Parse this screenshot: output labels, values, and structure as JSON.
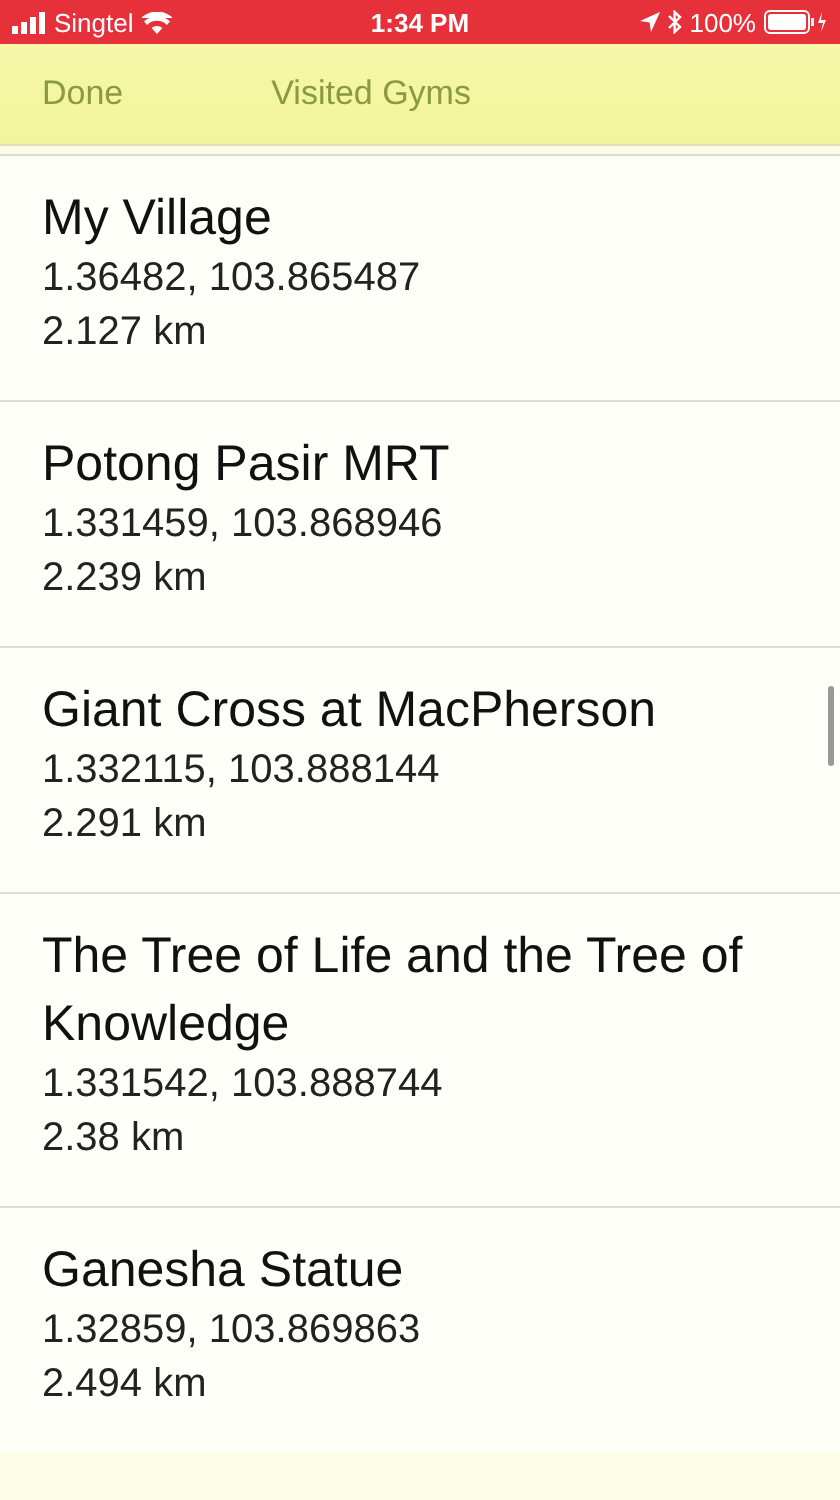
{
  "status_bar": {
    "carrier": "Singtel",
    "time": "1:34 PM",
    "battery": "100%"
  },
  "nav_bar": {
    "left_button": "Done",
    "title": "Visited Gyms"
  },
  "gyms": [
    {
      "name": "My Village",
      "coordinates": "1.36482, 103.865487",
      "distance": "2.127 km"
    },
    {
      "name": "Potong Pasir MRT",
      "coordinates": "1.331459, 103.868946",
      "distance": "2.239 km"
    },
    {
      "name": "Giant Cross at MacPherson",
      "coordinates": "1.332115, 103.888144",
      "distance": "2.291 km"
    },
    {
      "name": "The Tree of Life and the Tree of Knowledge",
      "coordinates": "1.331542, 103.888744",
      "distance": "2.38 km"
    },
    {
      "name": "Ganesha Statue",
      "coordinates": "1.32859, 103.869863",
      "distance": "2.494 km"
    }
  ]
}
